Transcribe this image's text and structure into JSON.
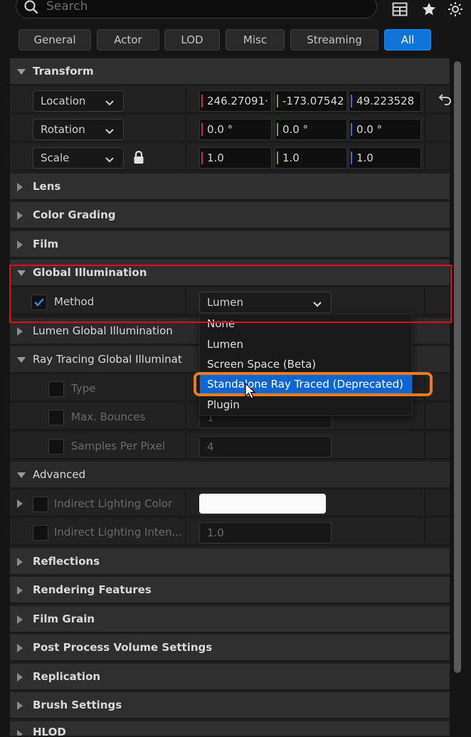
{
  "search": {
    "placeholder": "Search"
  },
  "top_icons": [
    "table-icon",
    "star-icon",
    "gear-icon"
  ],
  "filter_tabs": [
    {
      "label": "General",
      "active": false
    },
    {
      "label": "Actor",
      "active": false
    },
    {
      "label": "LOD",
      "active": false
    },
    {
      "label": "Misc",
      "active": false
    },
    {
      "label": "Streaming",
      "active": false
    },
    {
      "label": "All",
      "active": true
    }
  ],
  "transform": {
    "title": "Transform",
    "location": {
      "label": "Location",
      "x": "246.27091·",
      "y": "-173.07542",
      "z": "49.223528"
    },
    "rotation": {
      "label": "Rotation",
      "x": "0.0 °",
      "y": "0.0 °",
      "z": "0.0 °"
    },
    "scale": {
      "label": "Scale",
      "x": "1.0",
      "y": "1.0",
      "z": "1.0"
    }
  },
  "categories": {
    "lens": "Lens",
    "color_grading": "Color Grading",
    "film": "Film",
    "global_illumination": "Global Illumination",
    "lumen_gi": "Lumen Global Illumination",
    "ray_tracing_gi": "Ray Tracing Global Illuminat",
    "advanced": "Advanced",
    "reflections": "Reflections",
    "rendering_features": "Rendering Features",
    "film_grain": "Film Grain",
    "post_process": "Post Process Volume Settings",
    "replication": "Replication",
    "brush_settings": "Brush Settings",
    "hlod": "HLOD"
  },
  "gi_method": {
    "label": "Method",
    "value": "Lumen"
  },
  "ray_tracing_props": {
    "type": "Type",
    "max_bounces": {
      "label": "Max. Bounces",
      "value": "1"
    },
    "samples_per_pixel": {
      "label": "Samples Per Pixel",
      "value": "4"
    }
  },
  "advanced_props": {
    "indirect_color": "Indirect Lighting Color",
    "indirect_intensity": {
      "label": "Indirect Lighting Inten...",
      "value": "1.0"
    }
  },
  "dropdown_options": [
    {
      "label": "None",
      "selected": false
    },
    {
      "label": "Lumen",
      "selected": false
    },
    {
      "label": "Screen Space (Beta)",
      "selected": false
    },
    {
      "label": "Standalone Ray Traced (Deprecated)",
      "selected": true
    },
    {
      "label": "Plugin",
      "selected": false
    }
  ],
  "colors": {
    "x_axis": "#c0391b",
    "y_axis": "#6aa42a",
    "z_axis": "#3a6fc4",
    "accent": "#0e76d8",
    "highlight_red": "#e01010",
    "highlight_orange": "#f07a20"
  }
}
